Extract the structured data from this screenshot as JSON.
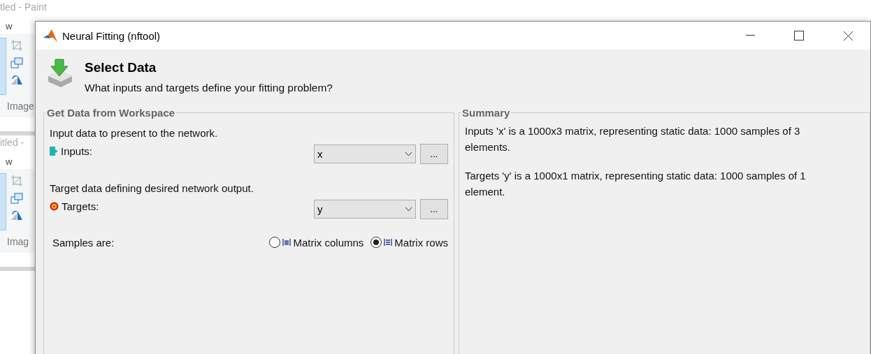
{
  "background_windows": [
    {
      "title": "tled - Paint",
      "tab": "w",
      "group": "Image"
    },
    {
      "title": "itled -",
      "tab": "w",
      "group": "Imag"
    }
  ],
  "window": {
    "title": "Neural Fitting (nftool)"
  },
  "header": {
    "title": "Select Data",
    "subtitle": "What inputs and targets define your fitting problem?"
  },
  "workspace": {
    "legend": "Get Data from Workspace",
    "rows": [
      {
        "kind": "inputs",
        "description": "Input data to present to the network.",
        "label": "Inputs:",
        "value": "x",
        "button": "..."
      },
      {
        "kind": "targets",
        "description": "Target data defining desired network output.",
        "label": "Targets:",
        "value": "y",
        "button": "..."
      }
    ],
    "samples": {
      "label": "Samples are:",
      "options": [
        {
          "kind": "columns",
          "label": "Matrix columns",
          "selected": false
        },
        {
          "kind": "rows",
          "label": "Matrix rows",
          "selected": true
        }
      ]
    }
  },
  "summary": {
    "legend": "Summary",
    "paragraphs": [
      "Inputs 'x' is a 1000x3 matrix, representing static data: 1000 samples of 3 elements.",
      "Targets 'y' is a 1000x1 matrix, representing static data: 1000 samples of 1 element."
    ]
  }
}
